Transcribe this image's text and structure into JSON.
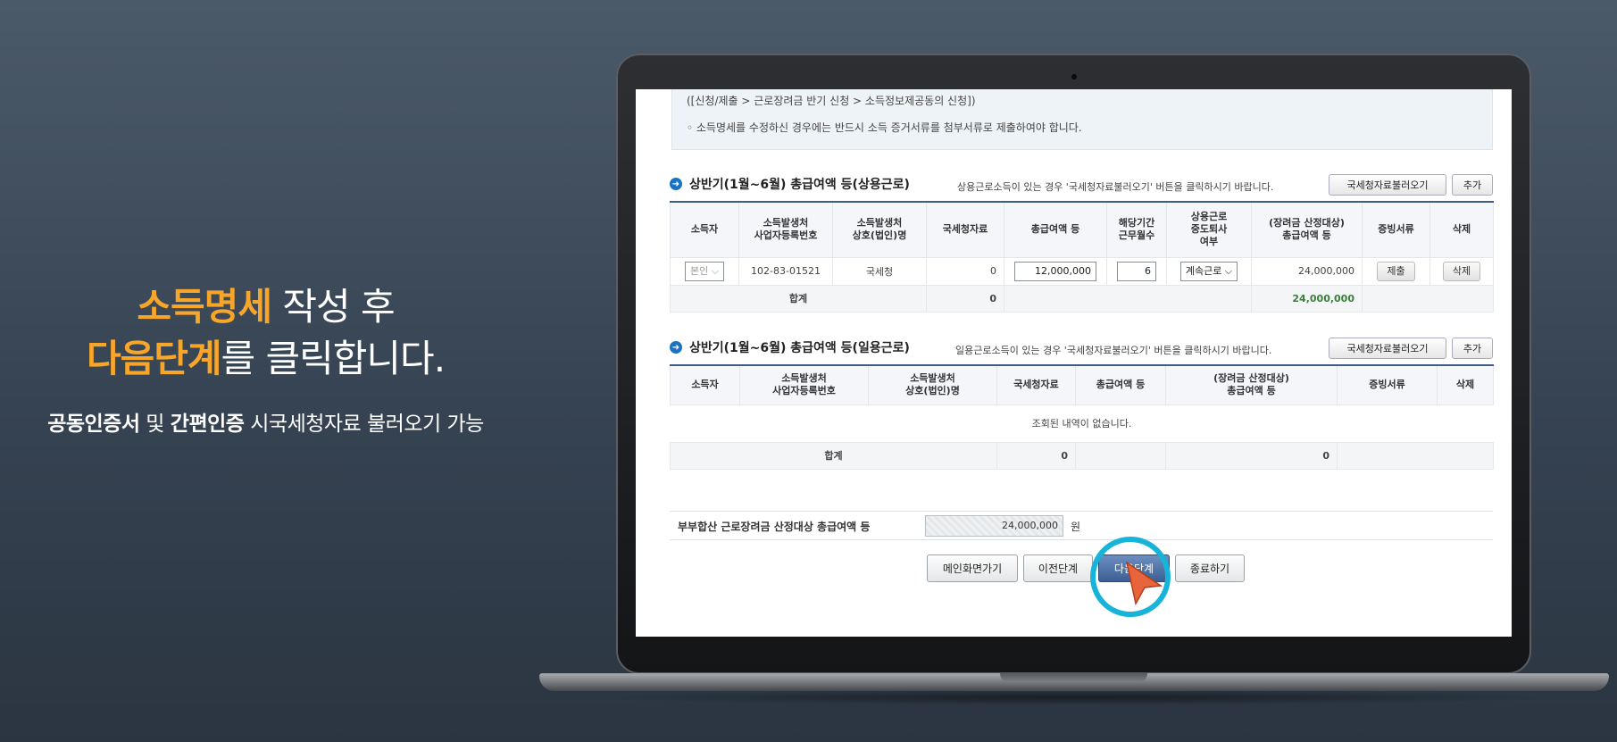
{
  "caption": {
    "line1_highlight": "소득명세",
    "line1_rest": " 작성 후",
    "line2_highlight": "다음단계",
    "line2_rest": "를 클릭합니다.",
    "sub_bold1": "공동인증서",
    "sub_text1": " 및 ",
    "sub_bold2": "간편인증",
    "sub_text2": " 시국세청자료 불러오기 가능"
  },
  "notice": {
    "path": "([신청/제출 > 근로장려금 반기 신청 > 소득정보제공동의 신청])",
    "warning": "◦ 소득명세를 수정하신 경우에는 반드시 소득 증거서류를 첨부서류로 제출하여야 합니다."
  },
  "section1": {
    "title": "상반기(1월~6월) 총급여액 등(상용근로)",
    "note": "상용근로소득이 있는 경우 '국세청자료불러오기' 버튼을 클릭하시기 바랍니다.",
    "load_button": "국세청자료불러오기",
    "add_button": "추가",
    "headers": [
      "소득자",
      "소득발생처\n사업자등록번호",
      "소득발생처\n상호(법인)명",
      "국세청자료",
      "총급여액 등",
      "해당기간\n근무월수",
      "상용근로\n중도퇴사\n여부",
      "(장려금 산정대상)\n총급여액 등",
      "증빙서류",
      "삭제"
    ],
    "row": {
      "earner": "본인",
      "biz_no": "102-83-01521",
      "biz_name": "국세청",
      "nts_amount": "0",
      "total_pay": "12,000,000",
      "months": "6",
      "status": "계속근로",
      "eligible_pay": "24,000,000",
      "proof_button": "제출",
      "delete_button": "삭제"
    },
    "sum": {
      "label": "합계",
      "nts_amount": "0",
      "eligible_pay": "24,000,000"
    }
  },
  "section2": {
    "title": "상반기(1월~6월) 총급여액 등(일용근로)",
    "note": "일용근로소득이 있는 경우 '국세청자료불러오기' 버튼을 클릭하시기 바랍니다.",
    "load_button": "국세청자료불러오기",
    "add_button": "추가",
    "headers": [
      "소득자",
      "소득발생처\n사업자등록번호",
      "소득발생처\n상호(법인)명",
      "국세청자료",
      "총급여액 등",
      "(장려금 산정대상)\n총급여액 등",
      "증빙서류",
      "삭제"
    ],
    "empty": "조회된 내역이 없습니다.",
    "sum": {
      "label": "합계",
      "nts_amount": "0",
      "eligible_pay": "0"
    }
  },
  "couple_total": {
    "label": "부부합산 근로장려금 산정대상 총급여액 등",
    "value": "24,000,000",
    "unit": "원"
  },
  "nav": {
    "main": "메인화면가기",
    "prev": "이전단계",
    "next": "다음단계",
    "end": "종료하기"
  },
  "colors": {
    "highlight": "#f8a62a",
    "accent": "#1a73c2",
    "ring": "#18b3d8",
    "cursor": "#e8643a"
  }
}
